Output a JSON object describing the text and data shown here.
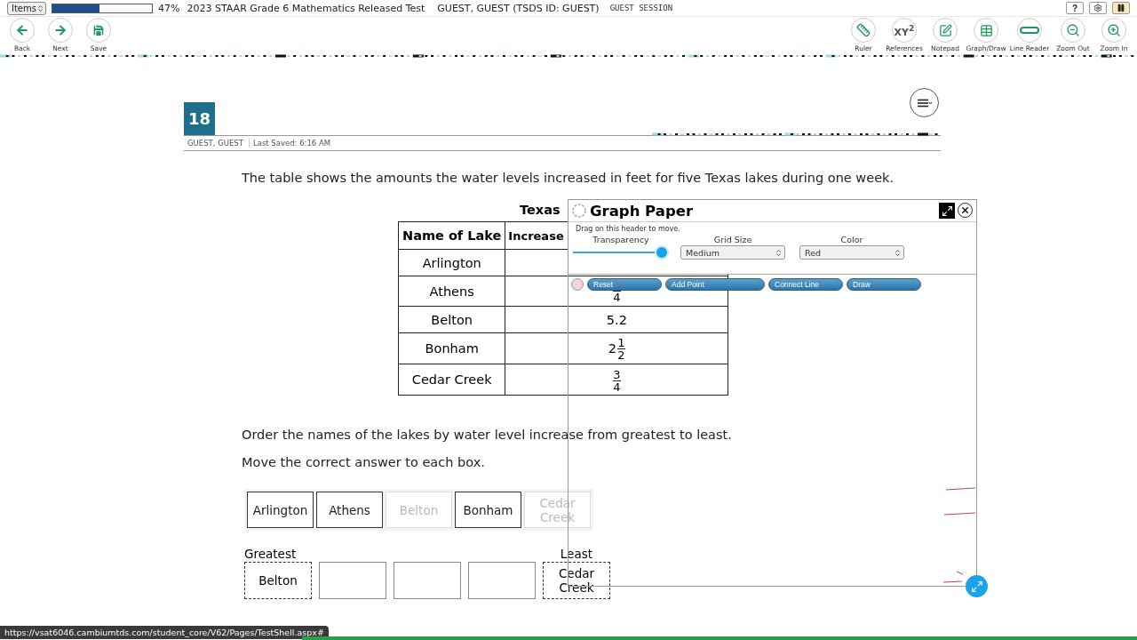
{
  "top_bar": {
    "items_select": "Items",
    "progress": {
      "level": 0.47,
      "reading": "47%"
    },
    "test_title": "2023 STAAR Grade 6 Mathematics Released Test",
    "student": "GUEST, GUEST (TSDS ID: GUEST)",
    "session": "GUEST SESSION",
    "buttons": [
      {
        "kind": "help",
        "label": "?"
      },
      {
        "kind": "settings"
      },
      {
        "kind": "pause"
      }
    ]
  },
  "nav_tools": [
    {
      "kind": "back",
      "label": "Back"
    },
    {
      "kind": "next",
      "label": "Next"
    },
    {
      "kind": "save",
      "label": "Save"
    }
  ],
  "tools": [
    {
      "kind": "ruler",
      "label": "Ruler"
    },
    {
      "kind": "references",
      "label": "References",
      "icon_text": "XY$^{2}$"
    },
    {
      "kind": "notepad",
      "label": "Notepad"
    },
    {
      "kind": "graph",
      "label": "Graph/Draw"
    },
    {
      "kind": "line_reader",
      "label": "Line Reader"
    },
    {
      "kind": "zoom_out",
      "label": "Zoom Out"
    },
    {
      "kind": "zoom_in",
      "label": "Zoom In"
    }
  ],
  "question": {
    "number": "18",
    "student": "GUEST, GUEST",
    "last_saved": "Last Saved: 6:16 AM",
    "prompt": "The table shows the amounts the water levels increased in feet for five Texas lakes during one week.",
    "table": {
      "title": "Texas",
      "columns": [
        "Name of Lake",
        "Increase"
      ],
      "rows": [
        {
          "lake": "Arlington"
        },
        {
          "lake": "Athens",
          "value": {
            "den": "4"
          }
        },
        {
          "lake": "Belton",
          "value": {
            "whole": "5.2"
          }
        },
        {
          "lake": "Bonham",
          "value": {
            "whole": "2",
            "num": "1",
            "den": "2"
          }
        },
        {
          "lake": "Cedar Creek",
          "value": {
            "num": "3",
            "den": "4"
          }
        }
      ]
    },
    "instruction": "Order the names of the lakes by water level increase from greatest to least.",
    "instruction_2": "Move the correct answer to each box.",
    "choices": [
      {
        "text": "Arlington",
        "used": false
      },
      {
        "text": "Athens",
        "used": false
      },
      {
        "text": "Belton",
        "used": true
      },
      {
        "text": "Bonham",
        "used": false
      },
      {
        "text": "Cedar Creek",
        "used": true
      }
    ],
    "slot_labels": {
      "first": "Greatest",
      "last": "Least"
    },
    "slots": [
      {
        "kind": "filled",
        "text": "Belton"
      },
      {
        "kind": "empty"
      },
      {
        "kind": "empty"
      },
      {
        "kind": "empty"
      },
      {
        "kind": "filled",
        "text": "Cedar Creek"
      }
    ]
  },
  "graph_paper": {
    "title": "Graph Paper",
    "hint": "Drag on this header to move.",
    "transparency": {
      "label": "Transparency",
      "level": 1
    },
    "grid_size": {
      "label": "Grid Size",
      "value": "Medium"
    },
    "color": {
      "label": "Color",
      "value": "Red"
    },
    "tools": [
      {
        "kind": "reset",
        "label": "Reset"
      },
      {
        "kind": "add_point",
        "label": "Add Point"
      },
      {
        "kind": "connect_line",
        "label": "Connect Line"
      },
      {
        "kind": "draw",
        "label": "Draw"
      }
    ]
  },
  "status_url": "https://vsat6046.cambiumtds.com/student_core/V62/Pages/TestShell.aspx#"
}
